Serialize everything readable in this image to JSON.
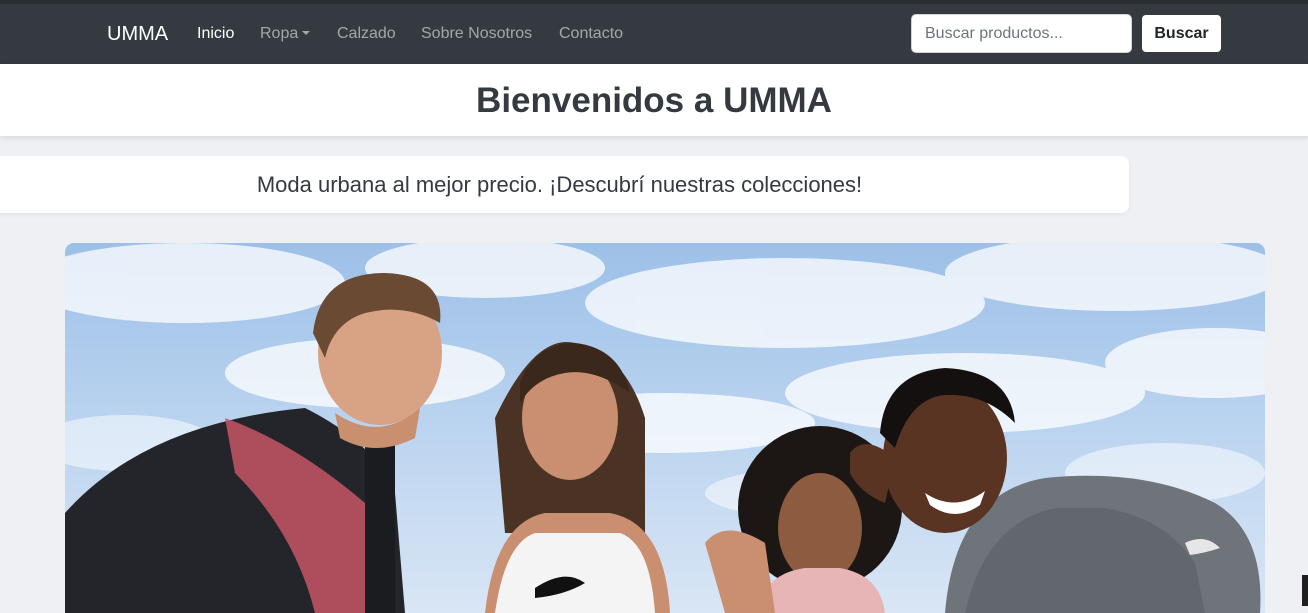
{
  "navbar": {
    "brand": "UMMA",
    "items": [
      {
        "label": "Inicio",
        "active": true,
        "dropdown": false
      },
      {
        "label": "Ropa",
        "active": false,
        "dropdown": true
      },
      {
        "label": "Calzado",
        "active": false,
        "dropdown": false
      },
      {
        "label": "Sobre Nosotros",
        "active": false,
        "dropdown": false
      },
      {
        "label": "Contacto",
        "active": false,
        "dropdown": false
      }
    ],
    "search": {
      "placeholder": "Buscar productos...",
      "value": "",
      "button_label": "Buscar"
    }
  },
  "hero_title": "Bienvenidos a UMMA",
  "tagline": "Moda urbana al mejor precio. ¡Descubrí nuestras colecciones!",
  "carousel": {
    "image_alt": "four smiling young people in sportswear against a cloudy blue sky"
  },
  "colors": {
    "navbar_bg": "#343a40",
    "page_bg": "#eef0f3",
    "text_dark": "#343a40"
  }
}
